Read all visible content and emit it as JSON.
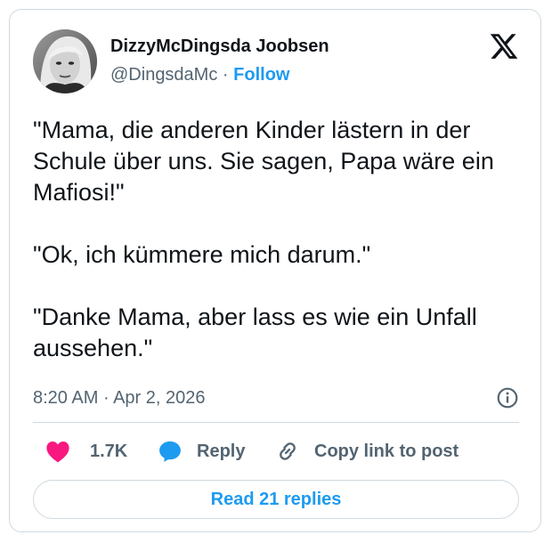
{
  "user": {
    "display_name": "DizzyMcDingsda Joobsen",
    "handle": "@DingsdaMc",
    "separator": "·",
    "follow_label": "Follow"
  },
  "tweet": {
    "paragraphs": [
      "\"Mama, die anderen Kinder lästern in der Schule über uns. Sie sagen, Papa wäre ein Mafiosi!\"",
      "\"Ok, ich kümmere mich darum.\"",
      "\"Danke Mama, aber lass es wie ein Unfall aussehen.\""
    ],
    "time": "8:20 AM",
    "separator": "·",
    "date": "Apr 2, 2026"
  },
  "actions": {
    "like_count": "1.7K",
    "reply_label": "Reply",
    "copy_link_label": "Copy link to post"
  },
  "footer": {
    "read_replies_label": "Read 21 replies"
  },
  "icons": {
    "brand_logo": "x-logo-icon",
    "info": "info-icon",
    "like": "heart-icon",
    "reply": "speech-bubble-icon",
    "copy_link": "link-icon"
  },
  "colors": {
    "link_blue": "#1d9bf0",
    "like_pink": "#f91880",
    "muted_gray": "#536471",
    "text": "#0f1419",
    "border": "#cfd9de"
  }
}
